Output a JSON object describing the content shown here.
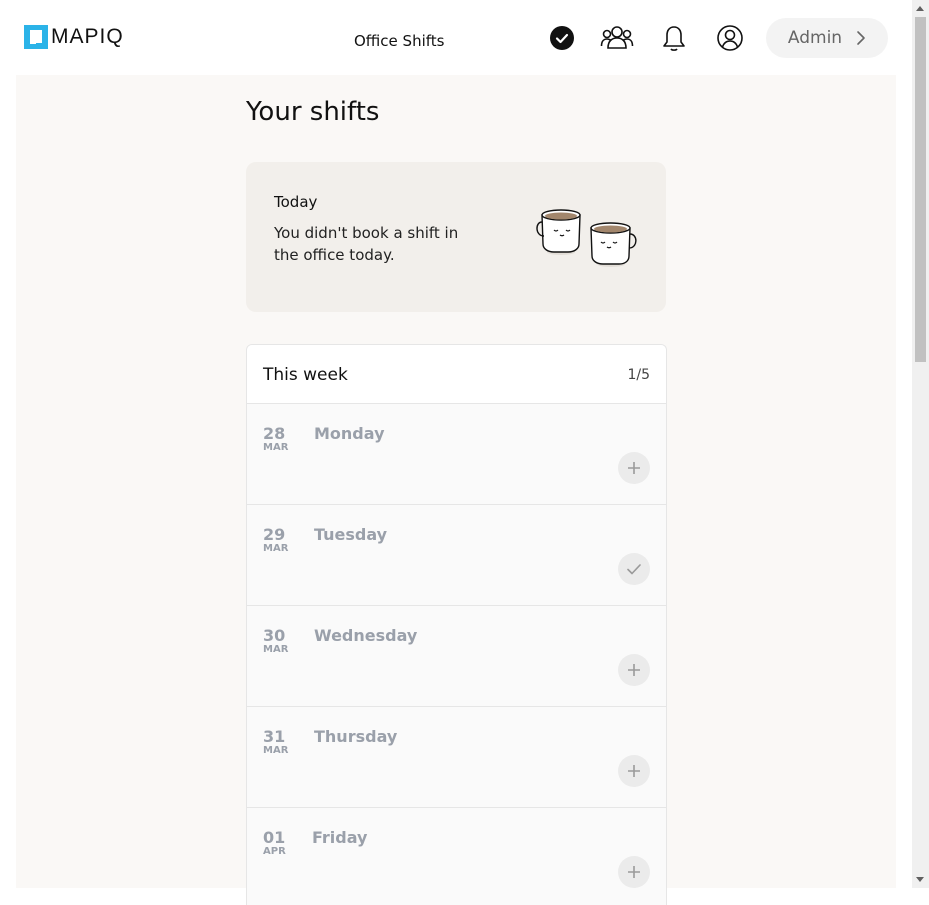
{
  "header": {
    "brand": "MAPIQ",
    "app_title": "Office Shifts",
    "icons": [
      "check-circle-icon",
      "people-icon",
      "bell-icon",
      "user-circle-icon"
    ],
    "admin_label": "Admin"
  },
  "main": {
    "page_title": "Your shifts",
    "today": {
      "title": "Today",
      "message": "You didn't book a shift in the office today."
    },
    "week": {
      "title": "This week",
      "count": "1/5",
      "days": [
        {
          "num": "28",
          "month": "MAR",
          "name": "Monday",
          "action": "add"
        },
        {
          "num": "29",
          "month": "MAR",
          "name": "Tuesday",
          "action": "booked"
        },
        {
          "num": "30",
          "month": "MAR",
          "name": "Wednesday",
          "action": "add"
        },
        {
          "num": "31",
          "month": "MAR",
          "name": "Thursday",
          "action": "add"
        },
        {
          "num": "01",
          "month": "APR",
          "name": "Friday",
          "action": "add"
        }
      ]
    }
  },
  "colors": {
    "brand": "#2bb3e8",
    "page_bg": "#faf8f6",
    "card_bg": "#f2efeb",
    "muted_text": "#9aa0aa"
  }
}
